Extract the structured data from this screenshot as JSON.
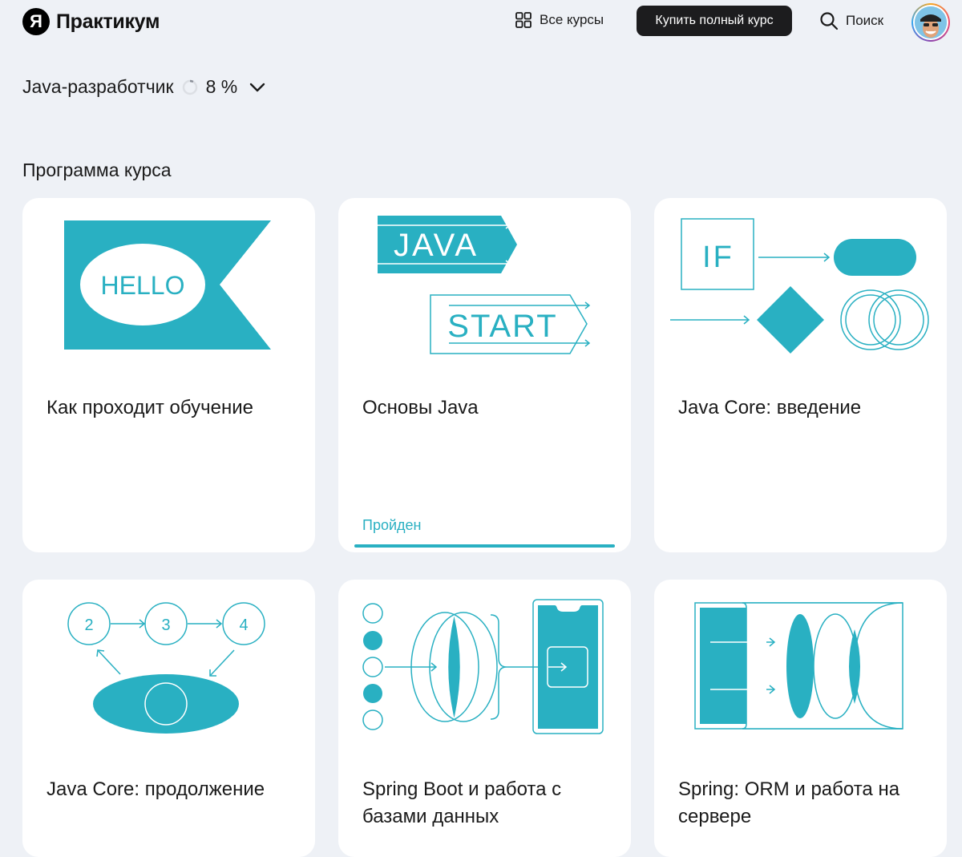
{
  "header": {
    "logo_mark": "Я",
    "logo_text": "Практикум",
    "all_courses_label": "Все курсы",
    "buy_button_label": "Купить полный курс",
    "search_label": "Поиск"
  },
  "course": {
    "name": "Java-разработчик",
    "progress_percent": 8,
    "progress_label": "8 %"
  },
  "program": {
    "title": "Программа курса",
    "cards": [
      {
        "title": "Как проходит обучение",
        "illustration": "hello-flag-illustration",
        "illustration_text": [
          "HELLO"
        ]
      },
      {
        "title": "Основы Java",
        "illustration": "java-start-illustration",
        "illustration_text": [
          "JAVA",
          "START"
        ],
        "status": "Пройден",
        "completed": true
      },
      {
        "title": "Java Core: введение",
        "illustration": "if-flowchart-illustration",
        "illustration_text": [
          "IF"
        ]
      },
      {
        "title": "Java Core: продолжение",
        "illustration": "steps-eye-illustration",
        "illustration_text": [
          "2",
          "3",
          "4"
        ]
      },
      {
        "title": "Spring Boot и работа с базами данных",
        "illustration": "phone-lens-illustration",
        "illustration_text": []
      },
      {
        "title": "Spring: ORM и работа на сервере",
        "illustration": "server-lens-illustration",
        "illustration_text": []
      }
    ]
  },
  "colors": {
    "accent": "#29b0c2",
    "background": "#eef1f6",
    "card": "#ffffff",
    "button_dark": "#1c1c1e"
  },
  "icons": [
    "grid-icon",
    "search-icon",
    "chevron-down-icon",
    "progress-ring-icon"
  ]
}
